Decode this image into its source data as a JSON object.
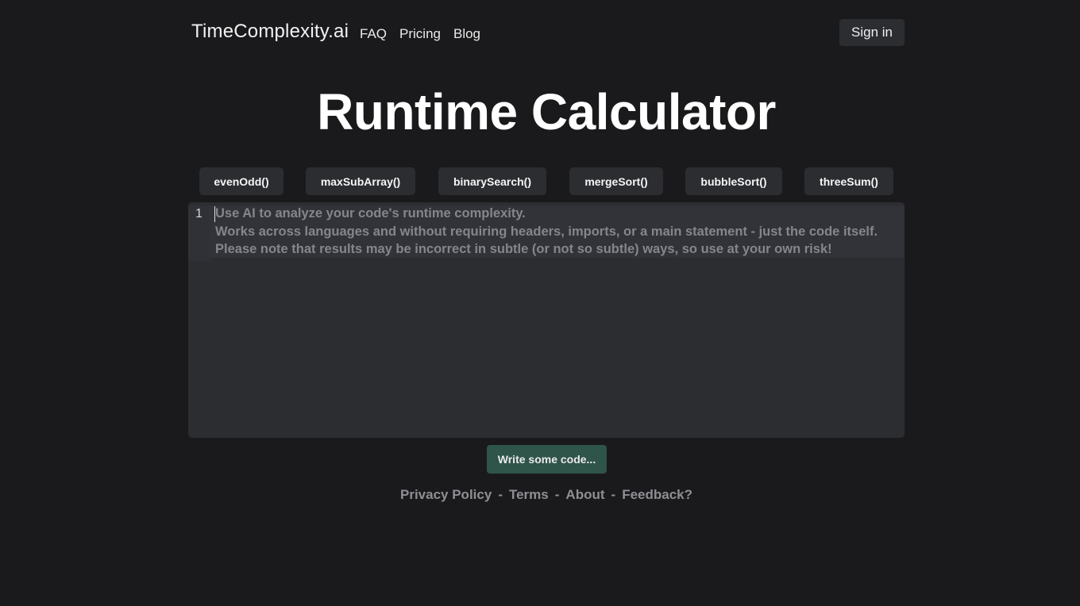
{
  "header": {
    "brand": "TimeComplexity.ai",
    "nav": [
      "FAQ",
      "Pricing",
      "Blog"
    ],
    "sign_in": "Sign in"
  },
  "main": {
    "title": "Runtime Calculator",
    "examples": [
      "evenOdd()",
      "maxSubArray()",
      "binarySearch()",
      "mergeSort()",
      "bubbleSort()",
      "threeSum()"
    ],
    "editor": {
      "line_number": "1",
      "placeholder": "Use AI to analyze your code's runtime complexity.\nWorks across languages and without requiring headers, imports, or a main statement - just the code itself.\nPlease note that results may be incorrect in subtle (or not so subtle) ways, so use at your own risk!"
    },
    "analyze_button": "Write some code..."
  },
  "footer": {
    "links": [
      "Privacy Policy",
      "Terms",
      "About",
      "Feedback?"
    ],
    "separator": "-"
  },
  "colors": {
    "background": "#1a1a1c",
    "surface": "#2c2d31",
    "accent_button": "#2f544a",
    "muted_text": "#8e8f94"
  }
}
